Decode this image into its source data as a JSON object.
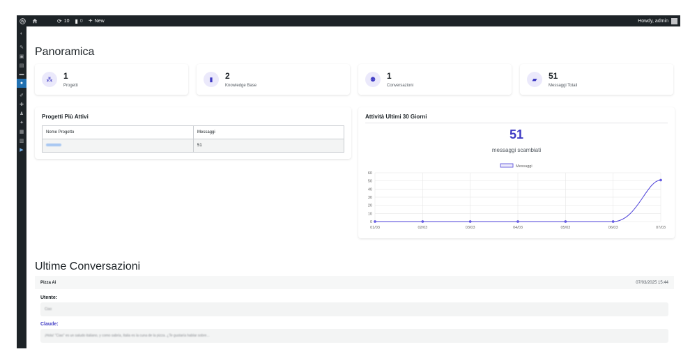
{
  "adminbar": {
    "updates_count": "10",
    "comments_count": "0",
    "new_label": "New",
    "howdy": "Howdy, admin"
  },
  "page": {
    "title": "Panoramica"
  },
  "stats": [
    {
      "value": "1",
      "label": "Progetti",
      "icon": "projects-icon"
    },
    {
      "value": "2",
      "label": "Knowledge Base",
      "icon": "book-icon"
    },
    {
      "value": "1",
      "label": "Conversazioni",
      "icon": "conversations-icon"
    },
    {
      "value": "51",
      "label": "Messaggi Totali",
      "icon": "messages-icon"
    }
  ],
  "top_projects": {
    "title": "Progetti Più Attivi",
    "columns": [
      "Nome Progetto",
      "Messaggi"
    ],
    "rows": [
      {
        "name": "Pizza AI",
        "messages": "51"
      }
    ]
  },
  "activity": {
    "title": "Attività Ultimi 30 Giorni",
    "total": "51",
    "total_label": "messaggi scambiati"
  },
  "chart_data": {
    "type": "line",
    "categories": [
      "01/03",
      "02/03",
      "03/03",
      "04/03",
      "05/03",
      "06/03",
      "07/03"
    ],
    "series": [
      {
        "name": "Messaggi",
        "values": [
          0,
          0,
          0,
          0,
          0,
          0,
          51
        ]
      }
    ],
    "ylim": [
      0,
      60
    ],
    "yticks": [
      "0",
      "10",
      "20",
      "30",
      "40",
      "50",
      "60"
    ],
    "grid": true,
    "legend": "top-center",
    "color": "#4b3fd8"
  },
  "recent": {
    "title": "Ultime Conversazioni",
    "conversation": {
      "project": "Pizza Ai",
      "timestamp": "07/03/2025 15:44",
      "user_label": "Utente:",
      "user_message": "Ciao",
      "assistant_label": "Claude:",
      "assistant_message": "¡Hola! \"Ciao\" es un saludo italiano, y como sabría, Italia es la cuna de la pizza. ¿Te gustaría hablar sobre..."
    }
  },
  "colors": {
    "accent": "#3f3bc4",
    "adminbar": "#1d2327",
    "link": "#2271b1"
  }
}
